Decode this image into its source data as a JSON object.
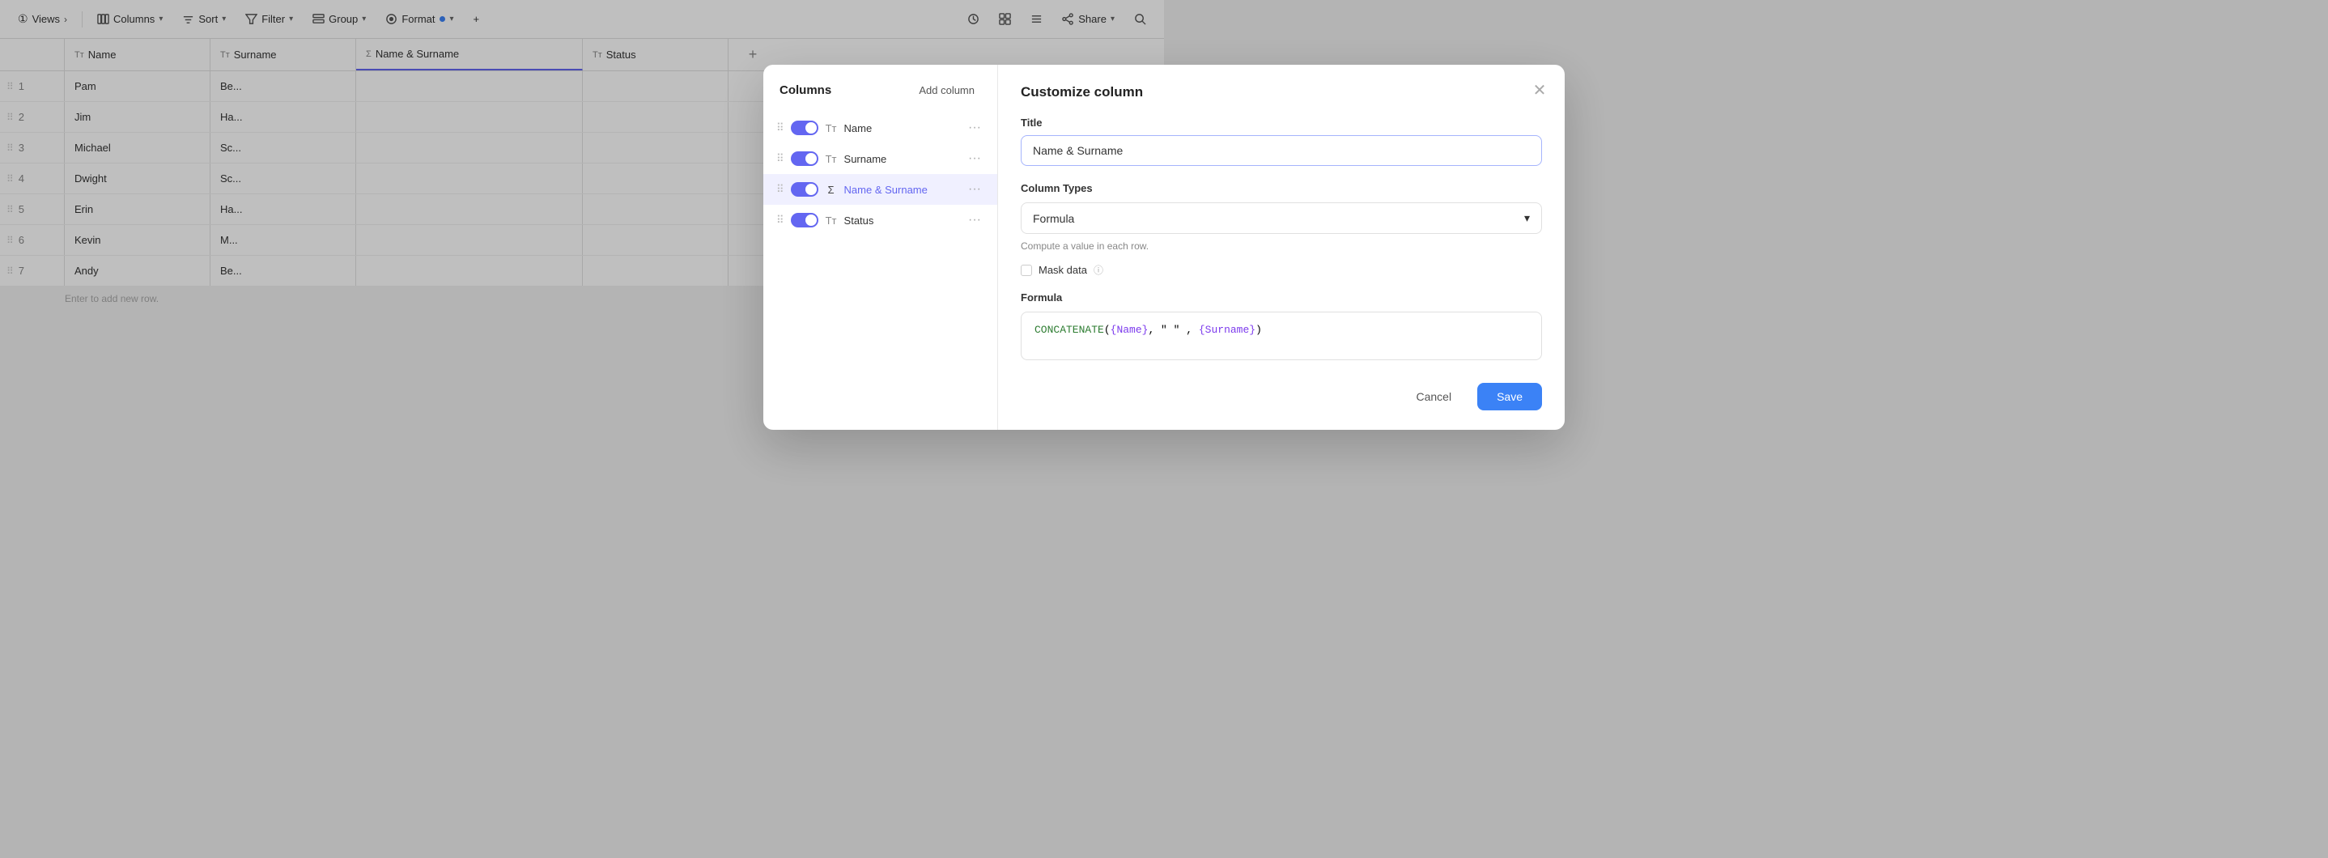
{
  "toolbar": {
    "views_label": "Views",
    "columns_label": "Columns",
    "sort_label": "Sort",
    "filter_label": "Filter",
    "group_label": "Group",
    "format_label": "Format",
    "share_label": "Share"
  },
  "columns": {
    "name": "Name",
    "surname": "Surname",
    "name_surname": "Name & Surname",
    "status": "Status",
    "add_btn": "+"
  },
  "rows": [
    {
      "num": 1,
      "name": "Pam",
      "surname": "Be...",
      "ns": "",
      "status": ""
    },
    {
      "num": 2,
      "name": "Jim",
      "surname": "Ha...",
      "ns": "",
      "status": ""
    },
    {
      "num": 3,
      "name": "Michael",
      "surname": "Sc...",
      "ns": "",
      "status": ""
    },
    {
      "num": 4,
      "name": "Dwight",
      "surname": "Sc...",
      "ns": "",
      "status": ""
    },
    {
      "num": 5,
      "name": "Erin",
      "surname": "Ha...",
      "ns": "",
      "status": ""
    },
    {
      "num": 6,
      "name": "Kevin",
      "surname": "M...",
      "ns": "",
      "status": ""
    },
    {
      "num": 7,
      "name": "Andy",
      "surname": "Be...",
      "ns": "",
      "status": ""
    }
  ],
  "add_row_label": "Enter to add new row.",
  "modal": {
    "left_title": "Columns",
    "add_column_label": "Add column",
    "col_list": [
      {
        "id": "name",
        "label": "Name",
        "type": "Tr",
        "active": false
      },
      {
        "id": "surname",
        "label": "Surname",
        "type": "Tr",
        "active": false
      },
      {
        "id": "name_surname",
        "label": "Name & Surname",
        "type": "Sigma",
        "active": true
      },
      {
        "id": "status",
        "label": "Status",
        "type": "Tr",
        "active": false
      }
    ],
    "right_title": "Customize column",
    "field_title_label": "Title",
    "title_value": "Name & Surname",
    "col_types_label": "Column Types",
    "col_type_value": "Formula",
    "compute_hint": "Compute a value in each row.",
    "mask_data_label": "Mask data",
    "formula_label": "Formula",
    "formula_func": "CONCATENATE",
    "formula_name_field": "{Name}",
    "formula_sep": ", \" \" , ",
    "formula_surname_field": "{Surname}",
    "formula_close": ")",
    "cancel_label": "Cancel",
    "save_label": "Save"
  }
}
